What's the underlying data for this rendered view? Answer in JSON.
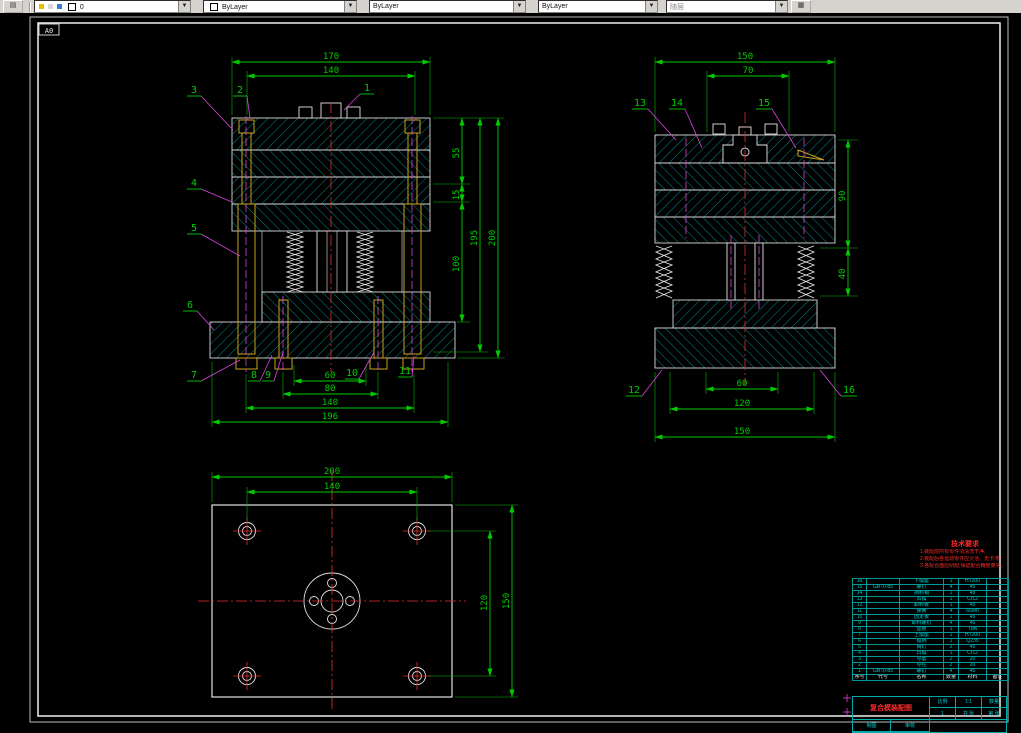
{
  "toolbar": {
    "layer_value": "0",
    "color_value": "ByLayer",
    "linetype_value": "ByLayer",
    "lineweight_value": "ByLayer",
    "plotstyle_value": "随层"
  },
  "sheet": {
    "size_label": "A0"
  },
  "views": {
    "front": {
      "dims": {
        "w_outer": "170",
        "w_inner": "140",
        "h1": "55",
        "h2": "15",
        "h3": "100",
        "h4": "195",
        "h5": "200",
        "b1": "60",
        "b2": "80",
        "b3": "140",
        "b4": "196"
      },
      "balloons": {
        "b1": "1",
        "b2": "2",
        "b3": "3",
        "b4": "4",
        "b5": "5",
        "b6": "6",
        "b7": "7",
        "b8": "8",
        "b9": "9",
        "b10": "10",
        "b11": "11"
      }
    },
    "side": {
      "dims": {
        "w1": "150",
        "w2": "70",
        "r1": "90",
        "r2": "40",
        "b1": "60",
        "b2": "120",
        "b3": "150"
      },
      "balloons": {
        "b12": "12",
        "b13": "13",
        "b14": "14",
        "b15": "15",
        "b16": "16"
      }
    },
    "plan": {
      "dims": {
        "t1": "200",
        "t2": "140",
        "r1": "120",
        "r2": "150"
      }
    }
  },
  "notes": {
    "title": "技术要求",
    "lines": [
      "1.装配前所有零件须清洗干净;",
      "2.装配后各运动零件应灵活、无卡滞;",
      "3.各配合面应研配,保证配合精度要求。"
    ]
  },
  "bom": {
    "headers": [
      "序号",
      "代号",
      "名称",
      "数量",
      "材料",
      "备注"
    ],
    "rows": [
      {
        "no": "16",
        "code": "",
        "name": "下模座",
        "qty": "1",
        "mat": "HT200",
        "rem": ""
      },
      {
        "no": "15",
        "code": "GB70-85",
        "name": "螺钉",
        "qty": "4",
        "mat": "45",
        "rem": ""
      },
      {
        "no": "14",
        "code": "",
        "name": "挡料销",
        "qty": "1",
        "mat": "45",
        "rem": ""
      },
      {
        "no": "13",
        "code": "",
        "name": "凹模",
        "qty": "1",
        "mat": "Cr12",
        "rem": ""
      },
      {
        "no": "12",
        "code": "",
        "name": "卸料板",
        "qty": "1",
        "mat": "45",
        "rem": ""
      },
      {
        "no": "11",
        "code": "",
        "name": "弹簧",
        "qty": "4",
        "mat": "65Mn",
        "rem": ""
      },
      {
        "no": "10",
        "code": "",
        "name": "固定板",
        "qty": "1",
        "mat": "45",
        "rem": ""
      },
      {
        "no": "9",
        "code": "",
        "name": "卸料螺钉",
        "qty": "4",
        "mat": "45",
        "rem": ""
      },
      {
        "no": "8",
        "code": "",
        "name": "垫板",
        "qty": "1",
        "mat": "T8A",
        "rem": ""
      },
      {
        "no": "7",
        "code": "",
        "name": "上模座",
        "qty": "1",
        "mat": "HT200",
        "rem": ""
      },
      {
        "no": "6",
        "code": "",
        "name": "模柄",
        "qty": "1",
        "mat": "Q235",
        "rem": ""
      },
      {
        "no": "5",
        "code": "",
        "name": "销钉",
        "qty": "2",
        "mat": "45",
        "rem": ""
      },
      {
        "no": "4",
        "code": "",
        "name": "凸模",
        "qty": "1",
        "mat": "Cr12",
        "rem": ""
      },
      {
        "no": "3",
        "code": "",
        "name": "导套",
        "qty": "2",
        "mat": "20",
        "rem": ""
      },
      {
        "no": "2",
        "code": "",
        "name": "导柱",
        "qty": "2",
        "mat": "20",
        "rem": ""
      },
      {
        "no": "1",
        "code": "GB70-85",
        "name": "螺钉",
        "qty": "4",
        "mat": "45",
        "rem": ""
      }
    ]
  },
  "titleblock": {
    "title": "复合模装配图",
    "cells": {
      "scale_label": "比例",
      "scale": "1:1",
      "qty_label": "数量",
      "qty": "1",
      "sheets": "共 张",
      "page": "第 张",
      "draw": "制图",
      "check": "审核"
    }
  }
}
